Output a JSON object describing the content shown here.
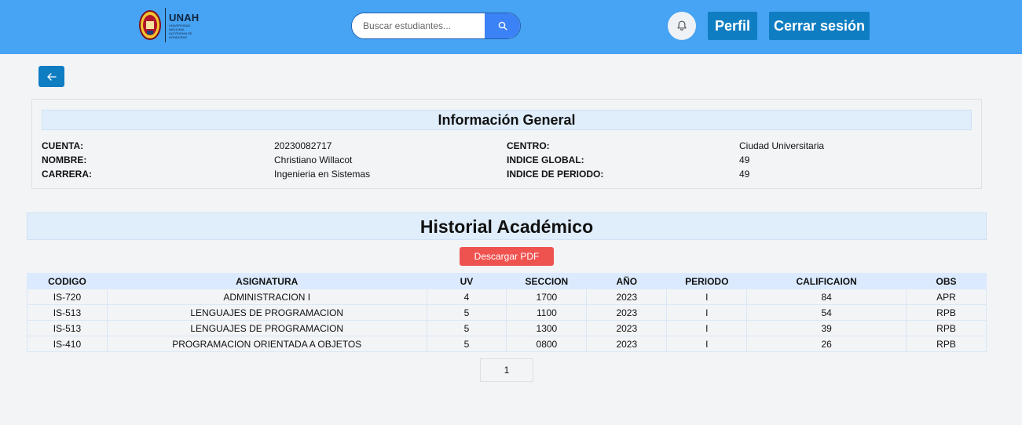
{
  "header": {
    "logo_title": "UNAH",
    "logo_subtitle": "UNIVERSIDAD NACIONAL AUTÓNOMA DE HONDURAS",
    "search_placeholder": "Buscar estudiantes...",
    "profile_label": "Perfil",
    "logout_label": "Cerrar sesión",
    "accent_color": "#47a3f3",
    "button_color": "#0f7dc2"
  },
  "general_info": {
    "title": "Información General",
    "rows": [
      {
        "label_left": "CUENTA:",
        "value_left": "20230082717",
        "label_right": "CENTRO:",
        "value_right": "Ciudad Universitaria"
      },
      {
        "label_left": "NOMBRE:",
        "value_left": "Christiano Willacot",
        "label_right": "INDICE GLOBAL:",
        "value_right": "49"
      },
      {
        "label_left": "CARRERA:",
        "value_left": "Ingenieria en Sistemas",
        "label_right": "INDICE DE PERIODO:",
        "value_right": "49"
      }
    ]
  },
  "history": {
    "title": "Historial Académico",
    "download_label": "Descargar PDF",
    "download_color": "#ef5350",
    "columns": [
      "CODIGO",
      "ASIGNATURA",
      "UV",
      "SECCION",
      "AÑO",
      "PERIODO",
      "CALIFICAION",
      "OBS"
    ],
    "rows": [
      [
        "IS-720",
        "ADMINISTRACION I",
        "4",
        "1700",
        "2023",
        "I",
        "84",
        "APR"
      ],
      [
        "IS-513",
        "LENGUAJES DE PROGRAMACION",
        "5",
        "1100",
        "2023",
        "I",
        "54",
        "RPB"
      ],
      [
        "IS-513",
        "LENGUAJES DE PROGRAMACION",
        "5",
        "1300",
        "2023",
        "I",
        "39",
        "RPB"
      ],
      [
        "IS-410",
        "PROGRAMACION ORIENTADA A OBJETOS",
        "5",
        "0800",
        "2023",
        "I",
        "26",
        "RPB"
      ]
    ],
    "current_page": "1"
  },
  "icons": {
    "search": "search-icon",
    "bell": "bell-icon",
    "back": "arrow-left-icon",
    "logo": "university-seal-icon"
  }
}
